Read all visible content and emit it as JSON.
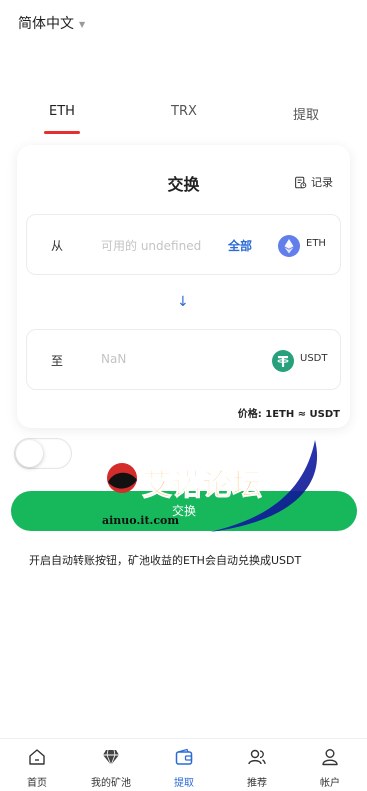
{
  "header": {
    "language": "简体中文"
  },
  "tabs": [
    {
      "label": "ETH",
      "active": true
    },
    {
      "label": "TRX",
      "active": false
    },
    {
      "label": "提取",
      "active": false
    }
  ],
  "card": {
    "title": "交换",
    "record_label": "记录",
    "from": {
      "label": "从",
      "placeholder": "可用的 undefined",
      "all_label": "全部",
      "coin": "ETH"
    },
    "to": {
      "label": "至",
      "value": "NaN",
      "coin": "USDT"
    },
    "price": "价格: 1ETH ≈ USDT"
  },
  "auto_transfer_toggle": {
    "on": false
  },
  "exchange_button": "交换",
  "note": "开启自动转账按钮，矿池收益的ETH会自动兑换成USDT",
  "watermark": {
    "title": "艾诺论坛",
    "domain": "ainuo.it.com"
  },
  "bottom_nav": [
    {
      "label": "首页",
      "icon": "home-icon",
      "active": false
    },
    {
      "label": "我的矿池",
      "icon": "diamond-icon",
      "active": false
    },
    {
      "label": "提取",
      "icon": "wallet-icon",
      "active": true
    },
    {
      "label": "推荐",
      "icon": "users-icon",
      "active": false
    },
    {
      "label": "帐户",
      "icon": "user-icon",
      "active": false
    }
  ],
  "colors": {
    "accent_blue": "#2b6bd6",
    "tab_underline_red": "#e6302e",
    "button_green": "#17b85c",
    "eth_purple": "#627eea",
    "usdt_green": "#26a17b"
  }
}
